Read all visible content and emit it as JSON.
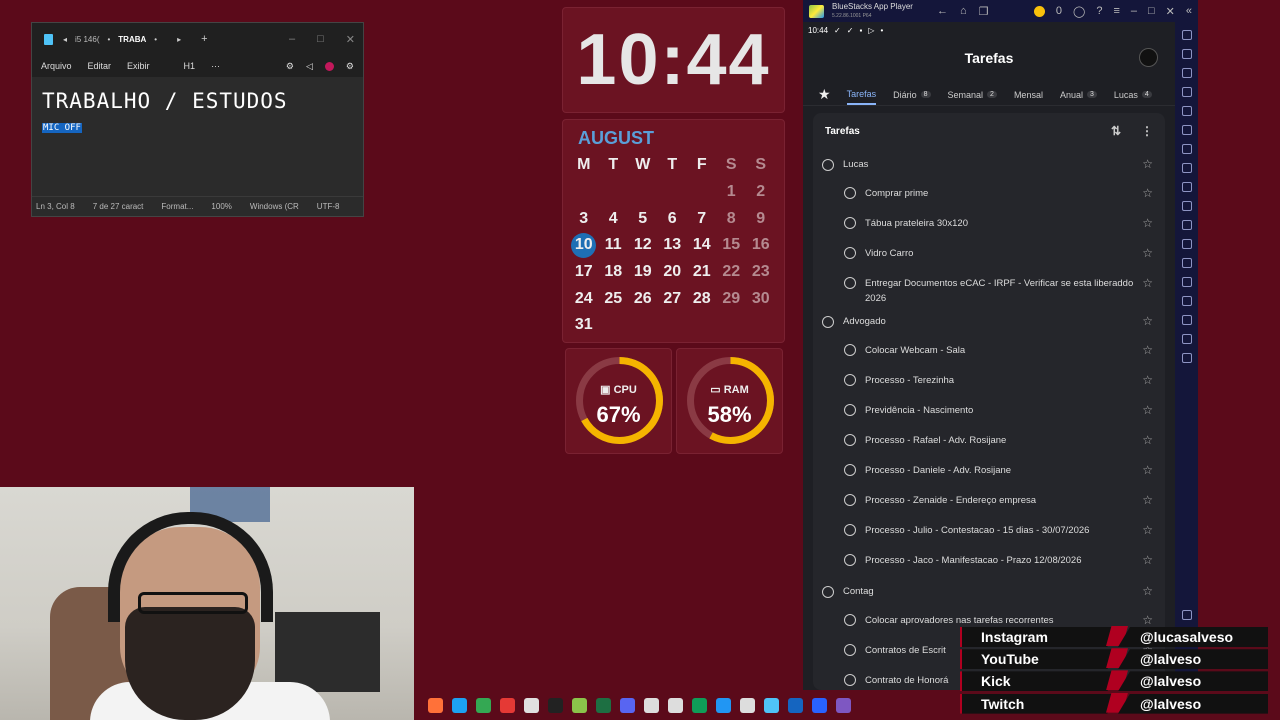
{
  "notepad": {
    "tabs": [
      "i5 146(",
      "TRABA"
    ],
    "menu": [
      "Arquivo",
      "Editar",
      "Exibir"
    ],
    "heading_style": "H1",
    "more": "···",
    "content_heading": "TRABALHO / ESTUDOS",
    "content_selected": "MIC OFF",
    "status": [
      "Ln 3, Col 8",
      "7 de 27 caract",
      "Format...",
      "100%",
      "Windows (CR",
      "UTF-8"
    ]
  },
  "clock": {
    "time": "10:44"
  },
  "calendar": {
    "month": "AUGUST",
    "weekdays": [
      "M",
      "T",
      "W",
      "T",
      "F",
      "S",
      "S"
    ],
    "days": [
      "",
      "",
      "",
      "",
      "",
      "1",
      "2",
      "3",
      "4",
      "5",
      "6",
      "7",
      "8",
      "9",
      "10",
      "11",
      "12",
      "13",
      "14",
      "15",
      "16",
      "17",
      "18",
      "19",
      "20",
      "21",
      "22",
      "23",
      "24",
      "25",
      "26",
      "27",
      "28",
      "29",
      "30",
      "31"
    ],
    "today": "10"
  },
  "gauges": [
    {
      "label": "CPU",
      "value": "67%",
      "fraction": 0.67
    },
    {
      "label": "RAM",
      "value": "58%",
      "fraction": 0.58
    }
  ],
  "bluestacks": {
    "title": "BlueStacks App Player",
    "version": "5.22.86.1001 P64",
    "coins": "0",
    "status_time": "10:44",
    "app_title": "Tarefas",
    "tabs": [
      {
        "label": "Tarefas",
        "count": ""
      },
      {
        "label": "Diário",
        "count": "8"
      },
      {
        "label": "Semanal",
        "count": "2"
      },
      {
        "label": "Mensal",
        "count": ""
      },
      {
        "label": "Anual",
        "count": "3"
      },
      {
        "label": "Lucas",
        "count": "4"
      }
    ],
    "list_title": "Tarefas",
    "items": [
      {
        "text": "Lucas",
        "level": 0
      },
      {
        "text": "Comprar prime",
        "level": 1
      },
      {
        "text": "Tábua prateleira 30x120",
        "level": 1
      },
      {
        "text": "Vidro Carro",
        "level": 1
      },
      {
        "text": "Entregar Documentos eCAC - IRPF - Verificar se esta liberaddo 2026",
        "level": 1
      },
      {
        "text": "Advogado",
        "level": 0
      },
      {
        "text": "Colocar Webcam - Sala",
        "level": 1
      },
      {
        "text": "Processo - Terezinha",
        "level": 1
      },
      {
        "text": "Previdência - Nascimento",
        "level": 1
      },
      {
        "text": "Processo - Rafael - Adv. Rosijane",
        "level": 1
      },
      {
        "text": "Processo - Daniele - Adv. Rosijane",
        "level": 1
      },
      {
        "text": "Processo - Zenaide - Endereço empresa",
        "level": 1
      },
      {
        "text": "Processo - Julio - Contestacao - 15 dias - 30/07/2026",
        "level": 1
      },
      {
        "text": "Processo - Jaco - Manifestacao - Prazo 12/08/2026",
        "level": 1
      },
      {
        "text": "Contag",
        "level": 0
      },
      {
        "text": "Colocar aprovadores nas tarefas recorrentes",
        "level": 1
      },
      {
        "text": "Contratos de Escrit",
        "level": 1
      },
      {
        "text": "Contrato de Honorá",
        "level": 1
      }
    ]
  },
  "socials": [
    {
      "name": "Instagram",
      "handle": "@lucasalveso"
    },
    {
      "name": "YouTube",
      "handle": "@lalveso"
    },
    {
      "name": "Kick",
      "handle": "@lalveso"
    },
    {
      "name": "Twitch",
      "handle": "@lalveso"
    }
  ],
  "colors": {
    "background": "#5b0a1a",
    "widget": "#6b1322",
    "gauge_arc": "#f5b400",
    "accent_blue": "#8ab4f8",
    "social_red": "#b00020"
  },
  "taskbar_icons": [
    "firefox-icon",
    "edge-icon",
    "chrome-icon",
    "opera-icon",
    "app-icon",
    "capcut-icon",
    "bluestacks-icon",
    "excel-icon",
    "discord-icon",
    "steam-icon",
    "app2-icon",
    "sheets-icon",
    "vscode-icon",
    "obs-icon",
    "notepad-icon",
    "outlook-icon",
    "powerautomate-icon",
    "app3-icon"
  ]
}
